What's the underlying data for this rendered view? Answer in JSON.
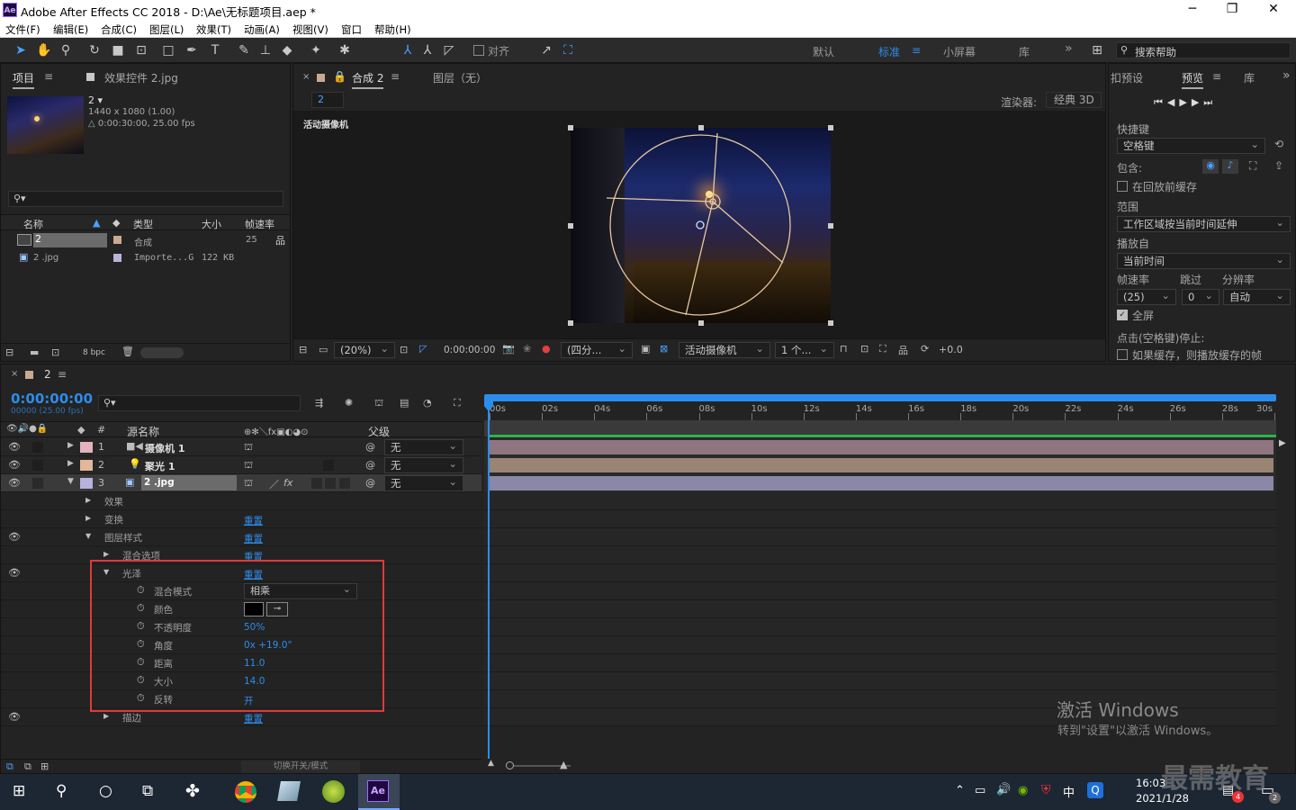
{
  "window": {
    "title": "Adobe After Effects CC 2018 - D:\\Ae\\无标题项目.aep *",
    "logo": "Ae",
    "minimize": "─",
    "maximize": "❐",
    "close": "✕"
  },
  "menu": [
    "文件(F)",
    "编辑(E)",
    "合成(C)",
    "图层(L)",
    "效果(T)",
    "动画(A)",
    "视图(V)",
    "窗口",
    "帮助(H)"
  ],
  "toolbar": {
    "snap_label": "对齐",
    "workspaces": [
      "默认",
      "标准",
      "小屏幕",
      "库"
    ],
    "active_workspace": "标准",
    "search_placeholder": "搜索帮助",
    "more": "»"
  },
  "project": {
    "tab_project": "项目",
    "tab_effects": "效果控件 2.jpg",
    "item_name": "2",
    "item_dims": "1440 x 1080 (1.00)",
    "item_duration": "△ 0:00:30:00, 25.00 fps",
    "columns": [
      "名称",
      "类型",
      "大小",
      "帧速率"
    ],
    "rows": [
      {
        "name": "2",
        "type": "合成",
        "size": "",
        "fps": "25"
      },
      {
        "name": "2 .jpg",
        "type": "Importe...G",
        "size": "122 KB",
        "fps": ""
      }
    ],
    "bpc": "8 bpc"
  },
  "comp": {
    "tab": "合成 2",
    "layer_tab": "图层（无）",
    "sub_tab": "2",
    "renderer_label": "渲染器:",
    "renderer": "经典 3D",
    "camera_label": "活动摄像机",
    "zoom": "(20%)",
    "timecode": "0:00:00:00",
    "view": "(四分...",
    "camera_select": "活动摄像机",
    "views": "1 个...",
    "exposure": "+0.0"
  },
  "preview": {
    "tab_effects": "扣预设",
    "tab_preview": "预览",
    "tab_lib": "库",
    "shortcut_label": "快捷键",
    "shortcut": "空格键",
    "include_label": "包含:",
    "cache_label": "在回放前缓存",
    "range_label": "范围",
    "range": "工作区域按当前时间延伸",
    "play_from_label": "播放自",
    "play_from": "当前时间",
    "fps_label": "帧速率",
    "skip_label": "跳过",
    "res_label": "分辨率",
    "fps": "(25)",
    "skip": "0",
    "res": "自动",
    "fullscreen": "全屏",
    "stop_label": "点击(空格键)停止:",
    "if_cached": "如果缓存，则播放缓存的帧"
  },
  "timeline": {
    "tab": "2",
    "timecode": "0:00:00:00",
    "frames": "00000 (25.00 fps)",
    "col_source": "源名称",
    "col_parent": "父级",
    "ruler": [
      "00s",
      "02s",
      "04s",
      "06s",
      "08s",
      "10s",
      "12s",
      "14s",
      "16s",
      "18s",
      "20s",
      "22s",
      "24s",
      "26s",
      "28s",
      "30s"
    ],
    "layers": [
      {
        "num": "1",
        "name": "摄像机 1",
        "parent": "无",
        "color": "#e3b3c0",
        "bar": "#8f7580"
      },
      {
        "num": "2",
        "name": "聚光 1",
        "parent": "无",
        "color": "#e2b79a",
        "bar": "#9a8474"
      },
      {
        "num": "3",
        "name": "2 .jpg",
        "parent": "无",
        "color": "#b6b3dd",
        "bar": "#8a87a8"
      }
    ],
    "props": {
      "effects": "效果",
      "transform": "变换",
      "reset": "重置",
      "layer_styles": "图层样式",
      "blend_options": "混合选项",
      "satin": "光泽",
      "blend_mode": "混合模式",
      "blend_value": "相乘",
      "color": "颜色",
      "opacity": "不透明度",
      "opacity_value": "50%",
      "angle": "角度",
      "angle_value": "0x +19.0°",
      "distance": "距离",
      "distance_value": "11.0",
      "size": "大小",
      "size_value": "14.0",
      "invert": "反转",
      "invert_value": "开",
      "stroke": "描边"
    },
    "switch_mode": "切换开关/模式"
  },
  "watermark": {
    "line1": "激活 Windows",
    "line2": "转到\"设置\"以激活 Windows。",
    "brand": "最需教育"
  },
  "taskbar": {
    "time": "16:03",
    "date": "2021/1/28",
    "ime": "中",
    "ae": "Ae",
    "badge": "4",
    "notif": "2"
  }
}
